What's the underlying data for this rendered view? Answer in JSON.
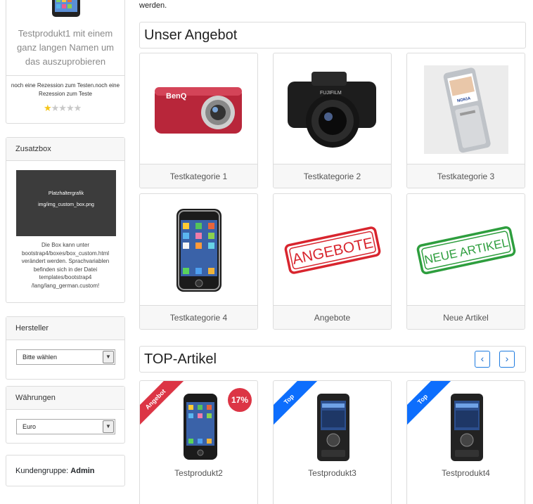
{
  "sidebar": {
    "product": {
      "name": "Testprodukt1 mit einem ganz langen Namen um das auszuprobieren",
      "review": "noch eine Rezession zum Testen.noch eine Rezession zum Teste",
      "rating": "1 / 5"
    },
    "custom_box": {
      "title": "Zusatzbox",
      "placeholder_line1": "Platzhaltergrafik",
      "placeholder_line2": "img/img_custom_box.png",
      "text": "Die Box kann unter bootstrap4/boxes/box_custom.html verändert werden. Sprachvariablen befinden sich in der Datei templates/bootstrap4 /lang/lang_german.custom!"
    },
    "manufacturer": {
      "title": "Hersteller",
      "selected": "Bitte wählen"
    },
    "currencies": {
      "title": "Währungen",
      "selected": "Euro"
    },
    "customer_group": {
      "label": "Kundengruppe:",
      "value": "Admin"
    }
  },
  "main": {
    "intro_tail": "werden.",
    "offers": {
      "title": "Unser Angebot",
      "tiles": [
        {
          "label": "Testkategorie 1",
          "icon": "camera-icon"
        },
        {
          "label": "Testkategorie 2",
          "icon": "dslr-camera-icon"
        },
        {
          "label": "Testkategorie 3",
          "icon": "phone-icon"
        },
        {
          "label": "Testkategorie 4",
          "icon": "smartphone-icon"
        },
        {
          "label": "Angebote",
          "stamp": "ANGEBOTE",
          "color": "#d8252e"
        },
        {
          "label": "Neue Artikel",
          "stamp": "NEUE ARTIKEL",
          "color": "#2e9e3e"
        }
      ]
    },
    "top": {
      "title": "TOP-Artikel",
      "prev_icon": "chevron-left-icon",
      "next_icon": "chevron-right-icon",
      "products": [
        {
          "name": "Testprodukt2",
          "ribbon": "Angebot",
          "ribbon_color": "#dc3545",
          "discount": "17%"
        },
        {
          "name": "Testprodukt3",
          "ribbon": "Top",
          "ribbon_color": "#0d6efd"
        },
        {
          "name": "Testprodukt4",
          "ribbon": "Top",
          "ribbon_color": "#0d6efd"
        }
      ]
    }
  }
}
